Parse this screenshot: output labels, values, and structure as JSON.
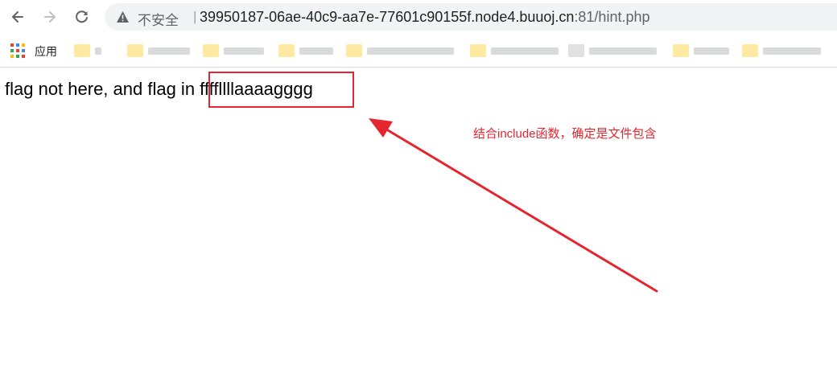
{
  "browser": {
    "security_label": "不安全",
    "url_host": "39950187-06ae-40c9-aa7e-77601c90155f.node4.buuoj.cn",
    "url_port_path": ":81/hint.php"
  },
  "bookmarks_bar": {
    "apps_label": "应用",
    "items_blurred": true
  },
  "page": {
    "text_before": "flag not here, and flag in ",
    "text_highlight": "ffffllllaaaagggg"
  },
  "annotation": {
    "note": "结合include函数，确定是文件包含",
    "color": "#e3262f"
  },
  "icons": [
    "back-arrow-icon",
    "forward-arrow-icon",
    "reload-icon",
    "warning-icon",
    "apps-grid-icon",
    "bookmark-folder-icon"
  ]
}
